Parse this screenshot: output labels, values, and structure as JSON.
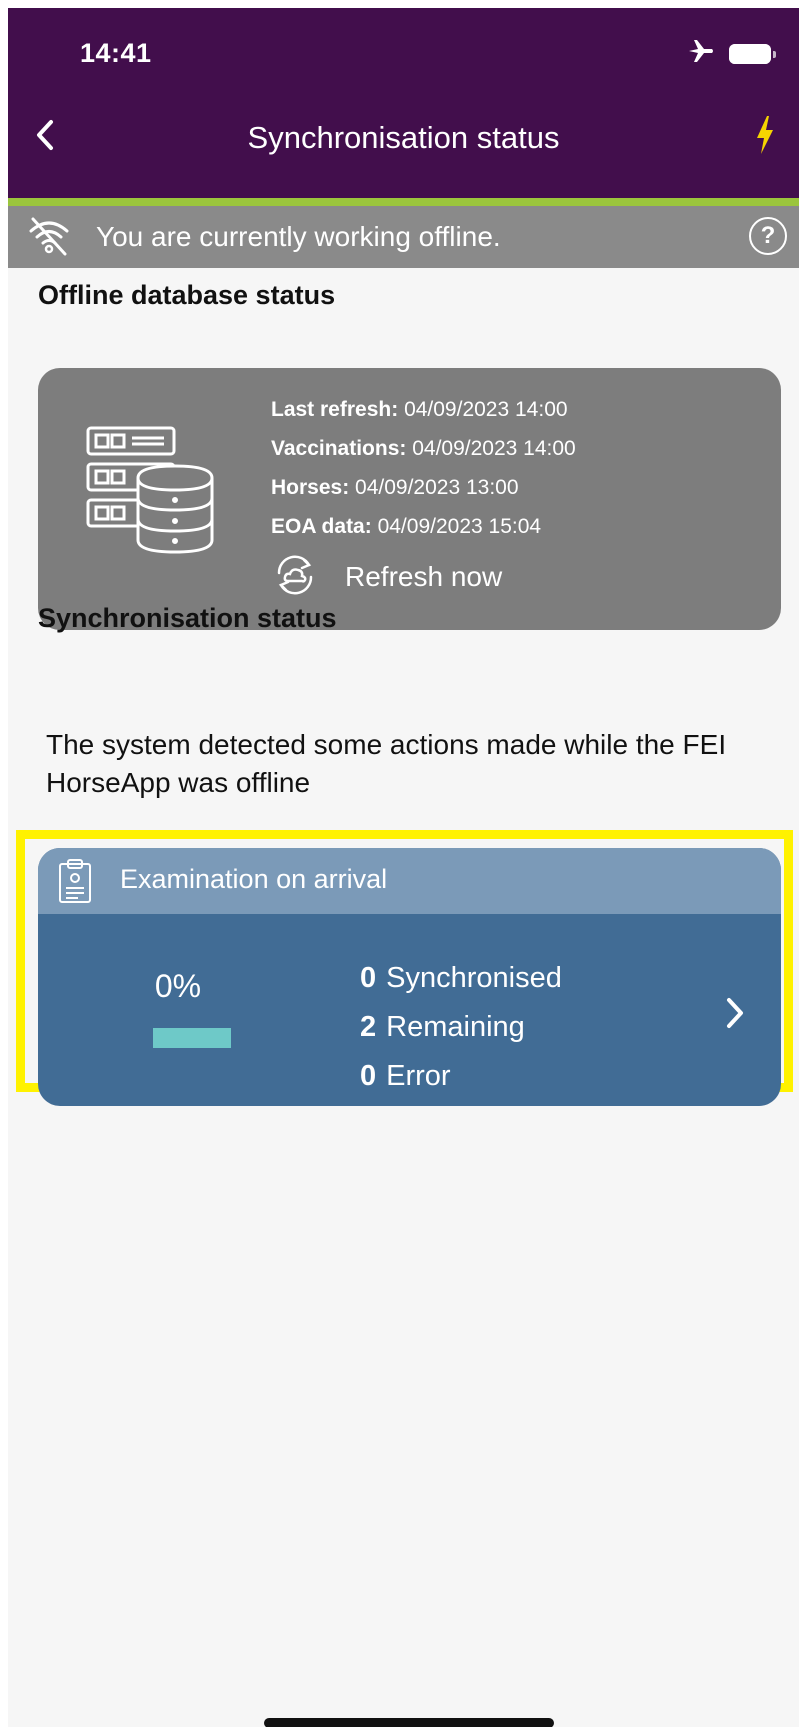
{
  "status_bar": {
    "time": "14:41"
  },
  "header": {
    "title": "Synchronisation status"
  },
  "offline_banner": {
    "text": "You are currently working offline.",
    "help": "?"
  },
  "offline_db": {
    "title": "Offline database status",
    "rows": [
      {
        "label": "Last refresh:",
        "value": "04/09/2023 14:00"
      },
      {
        "label": "Vaccinations:",
        "value": "04/09/2023 14:00"
      },
      {
        "label": "Horses:",
        "value": "04/09/2023 13:00"
      },
      {
        "label": "EOA data:",
        "value": "04/09/2023 15:04"
      }
    ],
    "refresh_label": "Refresh now"
  },
  "sync": {
    "title": "Synchronisation status",
    "description": "The system detected some actions made while the FEI HorseApp was offline",
    "card": {
      "title": "Examination on arrival",
      "percent_text": "0%",
      "progress_fraction": 0,
      "stats": [
        {
          "count": "0",
          "label": "Synchronised"
        },
        {
          "count": "2",
          "label": "Remaining"
        },
        {
          "count": "0",
          "label": "Error"
        }
      ]
    }
  },
  "colors": {
    "header_bg": "#420e4c",
    "accent_green": "#9bc53d",
    "bolt_yellow": "#f5d400",
    "banner_gray": "#8a8a8a",
    "card_gray": "#7d7d7d",
    "exam_card_blue": "#416c95",
    "exam_header_blue": "#7b9ab8",
    "progress_teal": "#6ec9c8",
    "highlight_yellow": "#fff200"
  },
  "icons": [
    "back-chevron-icon",
    "lightning-bolt-icon",
    "airplane-icon",
    "battery-icon",
    "wifi-off-icon",
    "help-icon",
    "database-server-icon",
    "cloud-sync-icon",
    "clipboard-icon",
    "chevron-right-icon"
  ]
}
